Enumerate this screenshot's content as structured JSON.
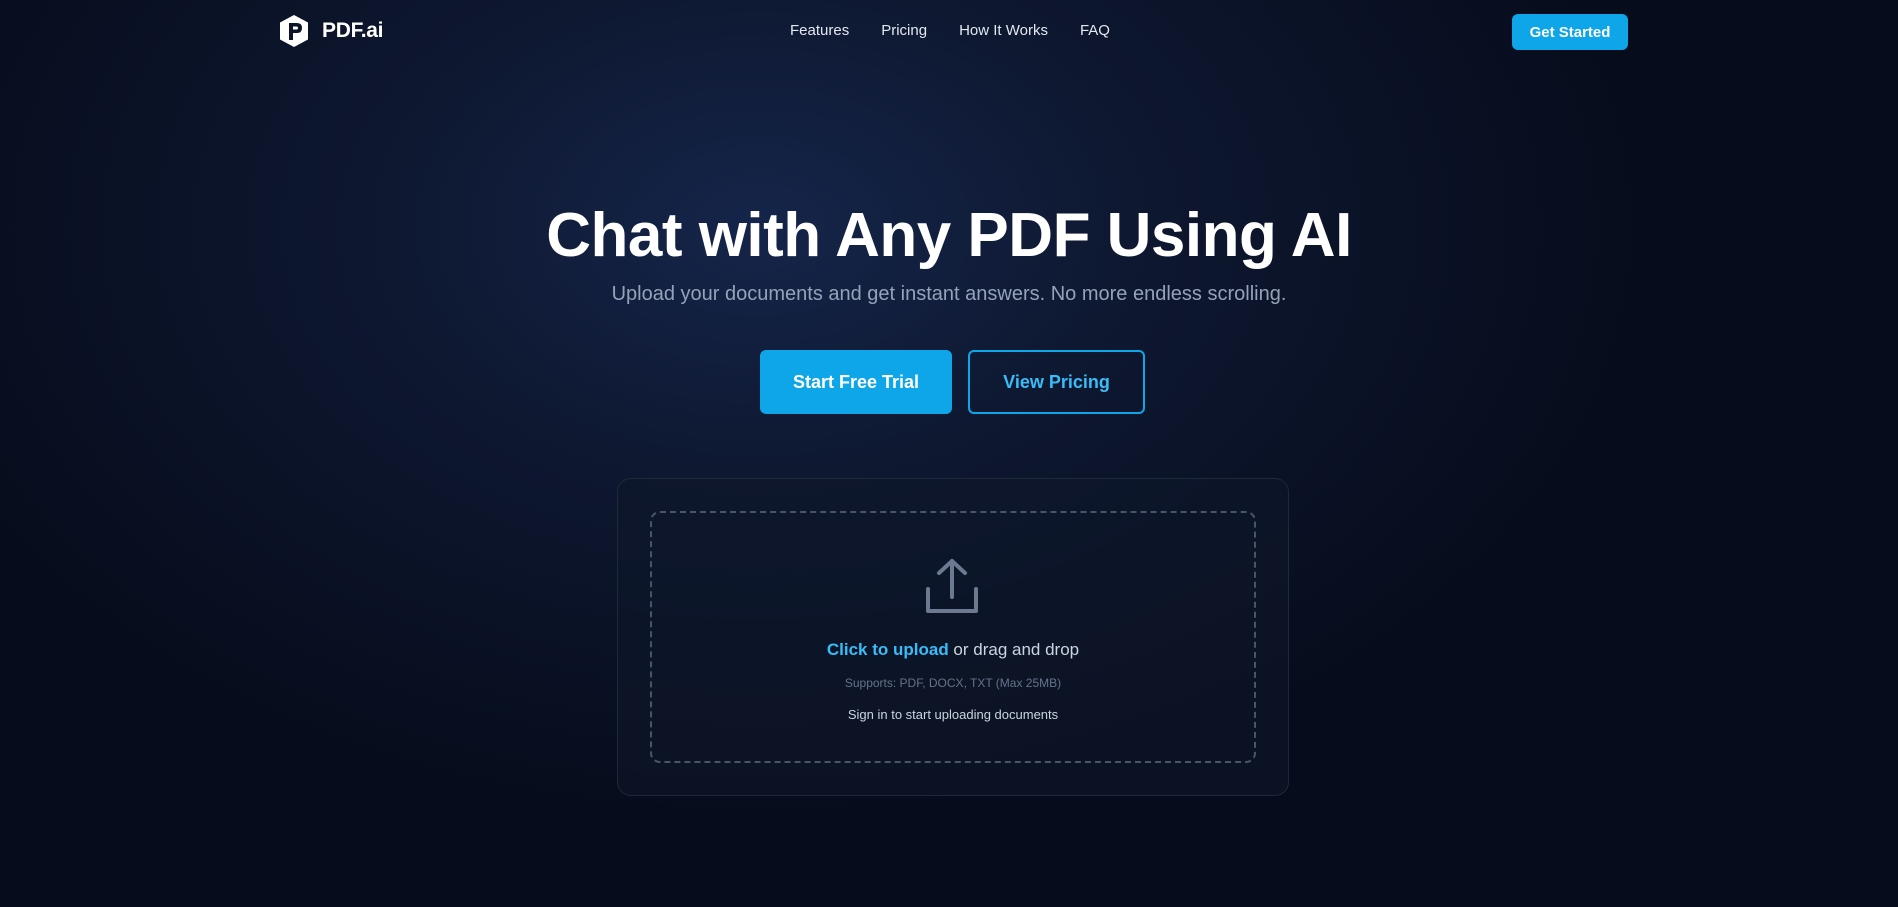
{
  "nav": {
    "brand": "PDF.ai",
    "brand_icon": "pdf-logo-icon",
    "links": [
      "Features",
      "Pricing",
      "How It Works",
      "FAQ"
    ],
    "cta_label": "Get Started"
  },
  "hero": {
    "title": "Chat with Any PDF Using AI",
    "subtitle": "Upload your documents and get instant answers. No more endless scrolling.",
    "primary_button": "Start Free Trial",
    "secondary_button": "View Pricing"
  },
  "upload": {
    "icon": "upload-icon",
    "link_text": "Click to upload",
    "rest_text": " or drag and drop",
    "supports": "Supports: PDF, DOCX, TXT (Max 25MB)",
    "note": "Sign in to start uploading documents"
  },
  "colors": {
    "accent": "#0ea5e9",
    "accent_text": "#38bdf8",
    "background": "#0a1226",
    "muted_text": "#94a3b8"
  }
}
